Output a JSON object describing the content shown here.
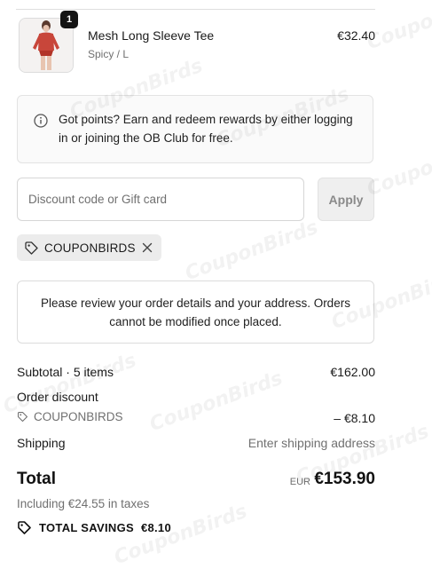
{
  "product": {
    "quantity": "1",
    "name": "Mesh Long Sleeve Tee",
    "variant": "Spicy / L",
    "price": "€32.40"
  },
  "points_notice": {
    "text": "Got points? Earn and redeem rewards by either logging in or joining the OB Club for free."
  },
  "discount": {
    "placeholder": "Discount code or Gift card",
    "value": "",
    "apply_label": "Apply",
    "applied_code": "COUPONBIRDS"
  },
  "review_notice": {
    "text": "Please review your order details and your address. Orders cannot be modified once placed."
  },
  "summary": {
    "subtotal_label": "Subtotal · 5 items",
    "subtotal_value": "€162.00",
    "order_discount_label": "Order discount",
    "discount_code": "COUPONBIRDS",
    "discount_value": "– €8.10",
    "shipping_label": "Shipping",
    "shipping_value": "Enter shipping address",
    "total_label": "Total",
    "total_currency": "EUR",
    "total_value": "€153.90",
    "taxes": "Including €24.55 in taxes",
    "savings_label": "TOTAL SAVINGS",
    "savings_value": "€8.10"
  },
  "watermark": "CouponBirds",
  "icons": {
    "info": "info-icon",
    "tag": "tag-icon",
    "remove": "close-icon"
  },
  "colors": {
    "text": "#1a1a1a",
    "muted": "#707070",
    "chip_bg": "#ececec",
    "notice_bg": "#fafafa"
  }
}
